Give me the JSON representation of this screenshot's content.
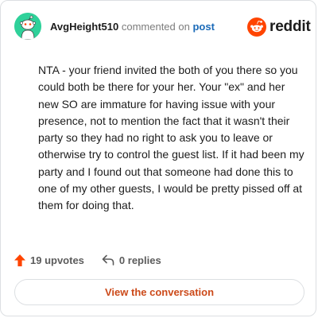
{
  "comment": {
    "username": "AvgHeight510",
    "commented_on_label": "commented on",
    "post_link_label": "post",
    "body": "NTA - your friend invited the both of you there so you could both be there for your her. Your \"ex\" and her new SO are immature for having issue with your presence, not to mention the fact that it wasn't their party so they had no right to ask you to leave or otherwise try to control the guest list. If it had been my party and I found out that someone had done this to one of my other guests, I would be pretty pissed off at them for doing that.",
    "upvotes_label": "19 upvotes",
    "replies_label": "0 replies"
  },
  "brand": {
    "name": "reddit",
    "accent_color": "#ff4500"
  },
  "actions": {
    "view_conversation_label": "View the conversation"
  },
  "icons": {
    "avatar": "snoo-avatar-icon",
    "brand_logo": "reddit-logo-icon",
    "upvote": "upvote-arrow-icon",
    "reply": "reply-arrow-icon"
  },
  "colors": {
    "avatar_bg": "#2fd19a",
    "upvote": "#ff4500",
    "cta_text": "#cc4a1a",
    "link": "#1a6ab8"
  }
}
